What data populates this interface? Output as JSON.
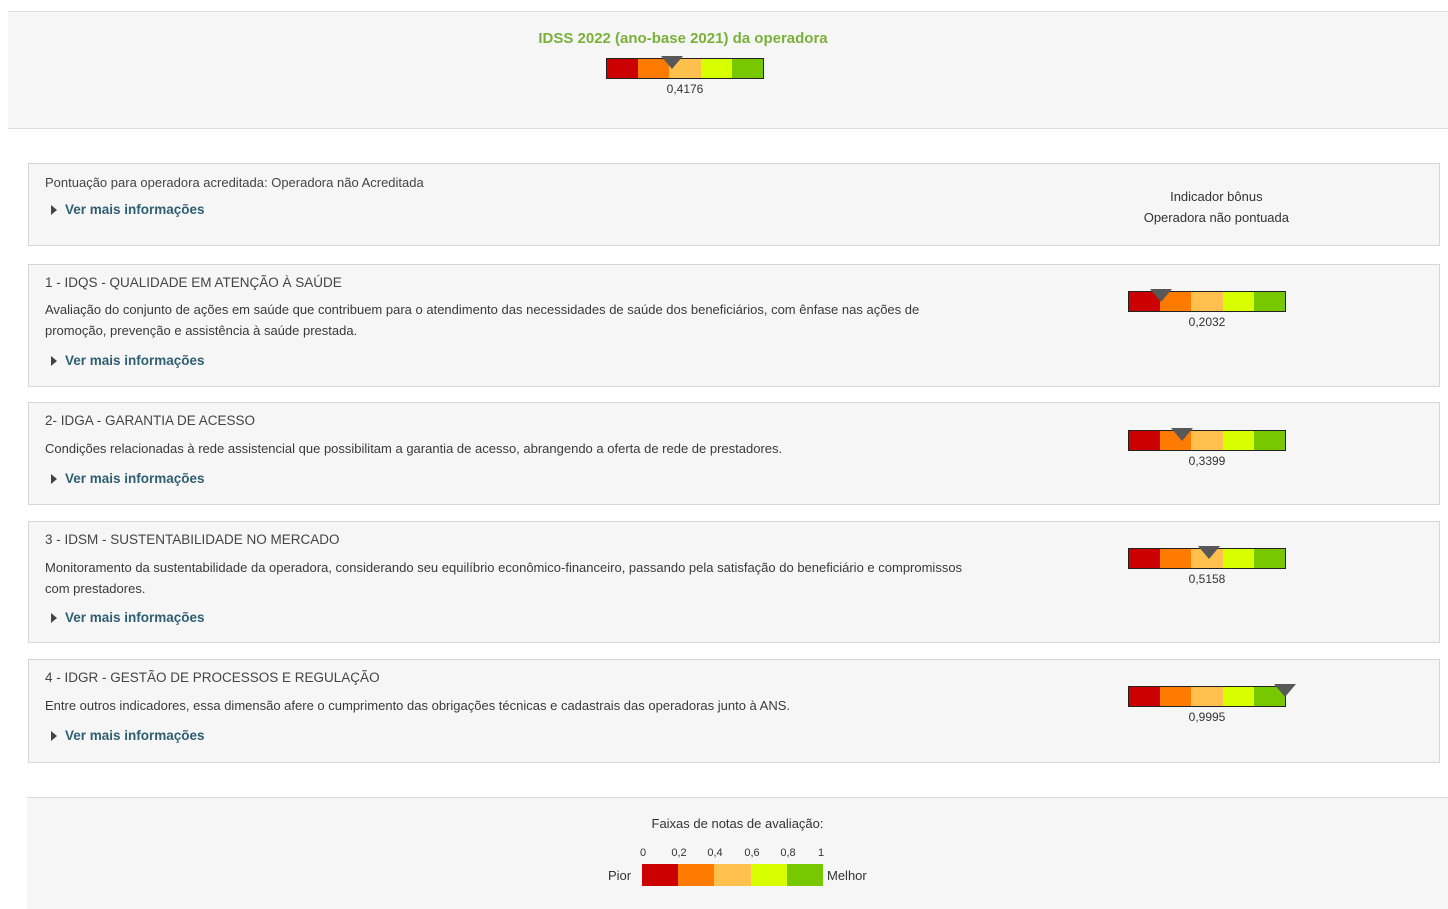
{
  "header": {
    "title": "IDSS 2022 (ano-base 2021) da operadora",
    "score": 0.4176,
    "score_label": "0,4176"
  },
  "scale_colors": [
    "#cc0000",
    "#ff7a00",
    "#ffc04d",
    "#d8ff00",
    "#77c800"
  ],
  "accreditation": {
    "text": "Pontuação para operadora acreditada: Operadora não Acreditada",
    "more_label": "Ver mais informações",
    "bonus_title": "Indicador bônus",
    "bonus_value": "Operadora não pontuada"
  },
  "dimensions": [
    {
      "title": "1 - IDQS - QUALIDADE EM ATENÇÃO À SAÚDE",
      "description": "Avaliação do conjunto de ações em saúde que contribuem para o atendimento das necessidades de saúde dos beneficiários, com ênfase nas ações de promoção, prevenção e assistência à saúde prestada.",
      "more_label": "Ver mais informações",
      "score": 0.2032,
      "score_label": "0,2032"
    },
    {
      "title": "2- IDGA - GARANTIA DE ACESSO",
      "description": "Condições relacionadas à rede assistencial que possibilitam a garantia de acesso, abrangendo a oferta de rede de prestadores.",
      "more_label": "Ver mais informações",
      "score": 0.3399,
      "score_label": "0,3399"
    },
    {
      "title": "3 - IDSM - SUSTENTABILIDADE NO MERCADO",
      "description": "Monitoramento da sustentabilidade da operadora, considerando seu equilíbrio econômico-financeiro, passando pela satisfação do beneficiário e compromissos com prestadores.",
      "more_label": "Ver mais informações",
      "score": 0.5158,
      "score_label": "0,5158"
    },
    {
      "title": "4 - IDGR - GESTÃO DE PROCESSOS E REGULAÇÃO",
      "description": "Entre outros indicadores, essa dimensão afere o cumprimento das obrigações técnicas e cadastrais das operadoras junto à ANS.",
      "more_label": "Ver mais informações",
      "score": 0.9995,
      "score_label": "0,9995"
    }
  ],
  "legend": {
    "caption": "Faixas de notas de avaliação:",
    "ticks": [
      "0",
      "0,2",
      "0,4",
      "0,6",
      "0,8",
      "1"
    ],
    "worst_label": "Pior",
    "best_label": "Melhor"
  }
}
